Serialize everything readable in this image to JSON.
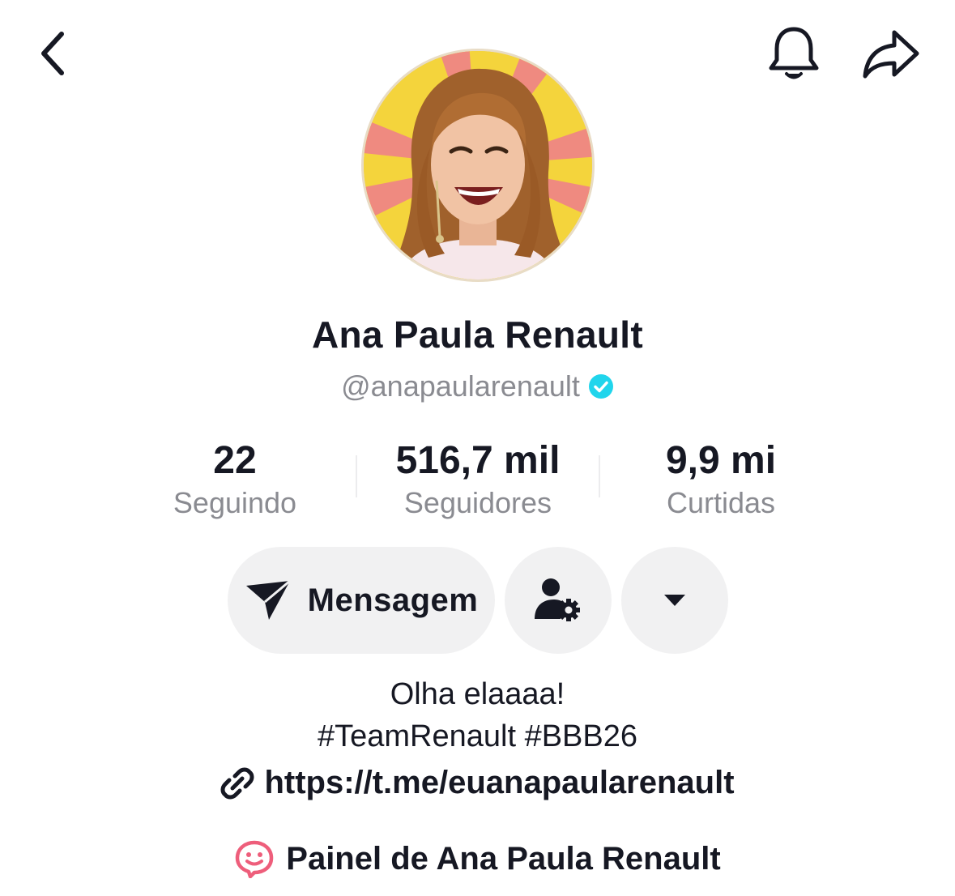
{
  "header": {
    "back_icon": "chevron-left-icon",
    "bell_icon": "bell-icon",
    "share_icon": "share-arrow-icon"
  },
  "profile": {
    "avatar": "profile-photo",
    "display_name": "Ana Paula Renault",
    "handle": "@anapaularenault",
    "verified_color": "#20d5ec"
  },
  "stats": [
    {
      "value": "22",
      "label": "Seguindo"
    },
    {
      "value": "516,7 mil",
      "label": "Seguidores"
    },
    {
      "value": "9,9 mi",
      "label": "Curtidas"
    }
  ],
  "actions": {
    "message_label": "Mensagem",
    "message_icon": "send-icon",
    "friends_icon": "user-settings-icon",
    "more_icon": "caret-down-icon"
  },
  "bio": {
    "line1": "Olha elaaaa!",
    "line2": "#TeamRenault #BBB26",
    "link": "https://t.me/euanapaularenault",
    "link_icon": "link-icon"
  },
  "panel": {
    "label": "Painel de Ana Paula Renault",
    "icon": "smile-bubble-icon",
    "icon_color": "#ee5e7b"
  }
}
